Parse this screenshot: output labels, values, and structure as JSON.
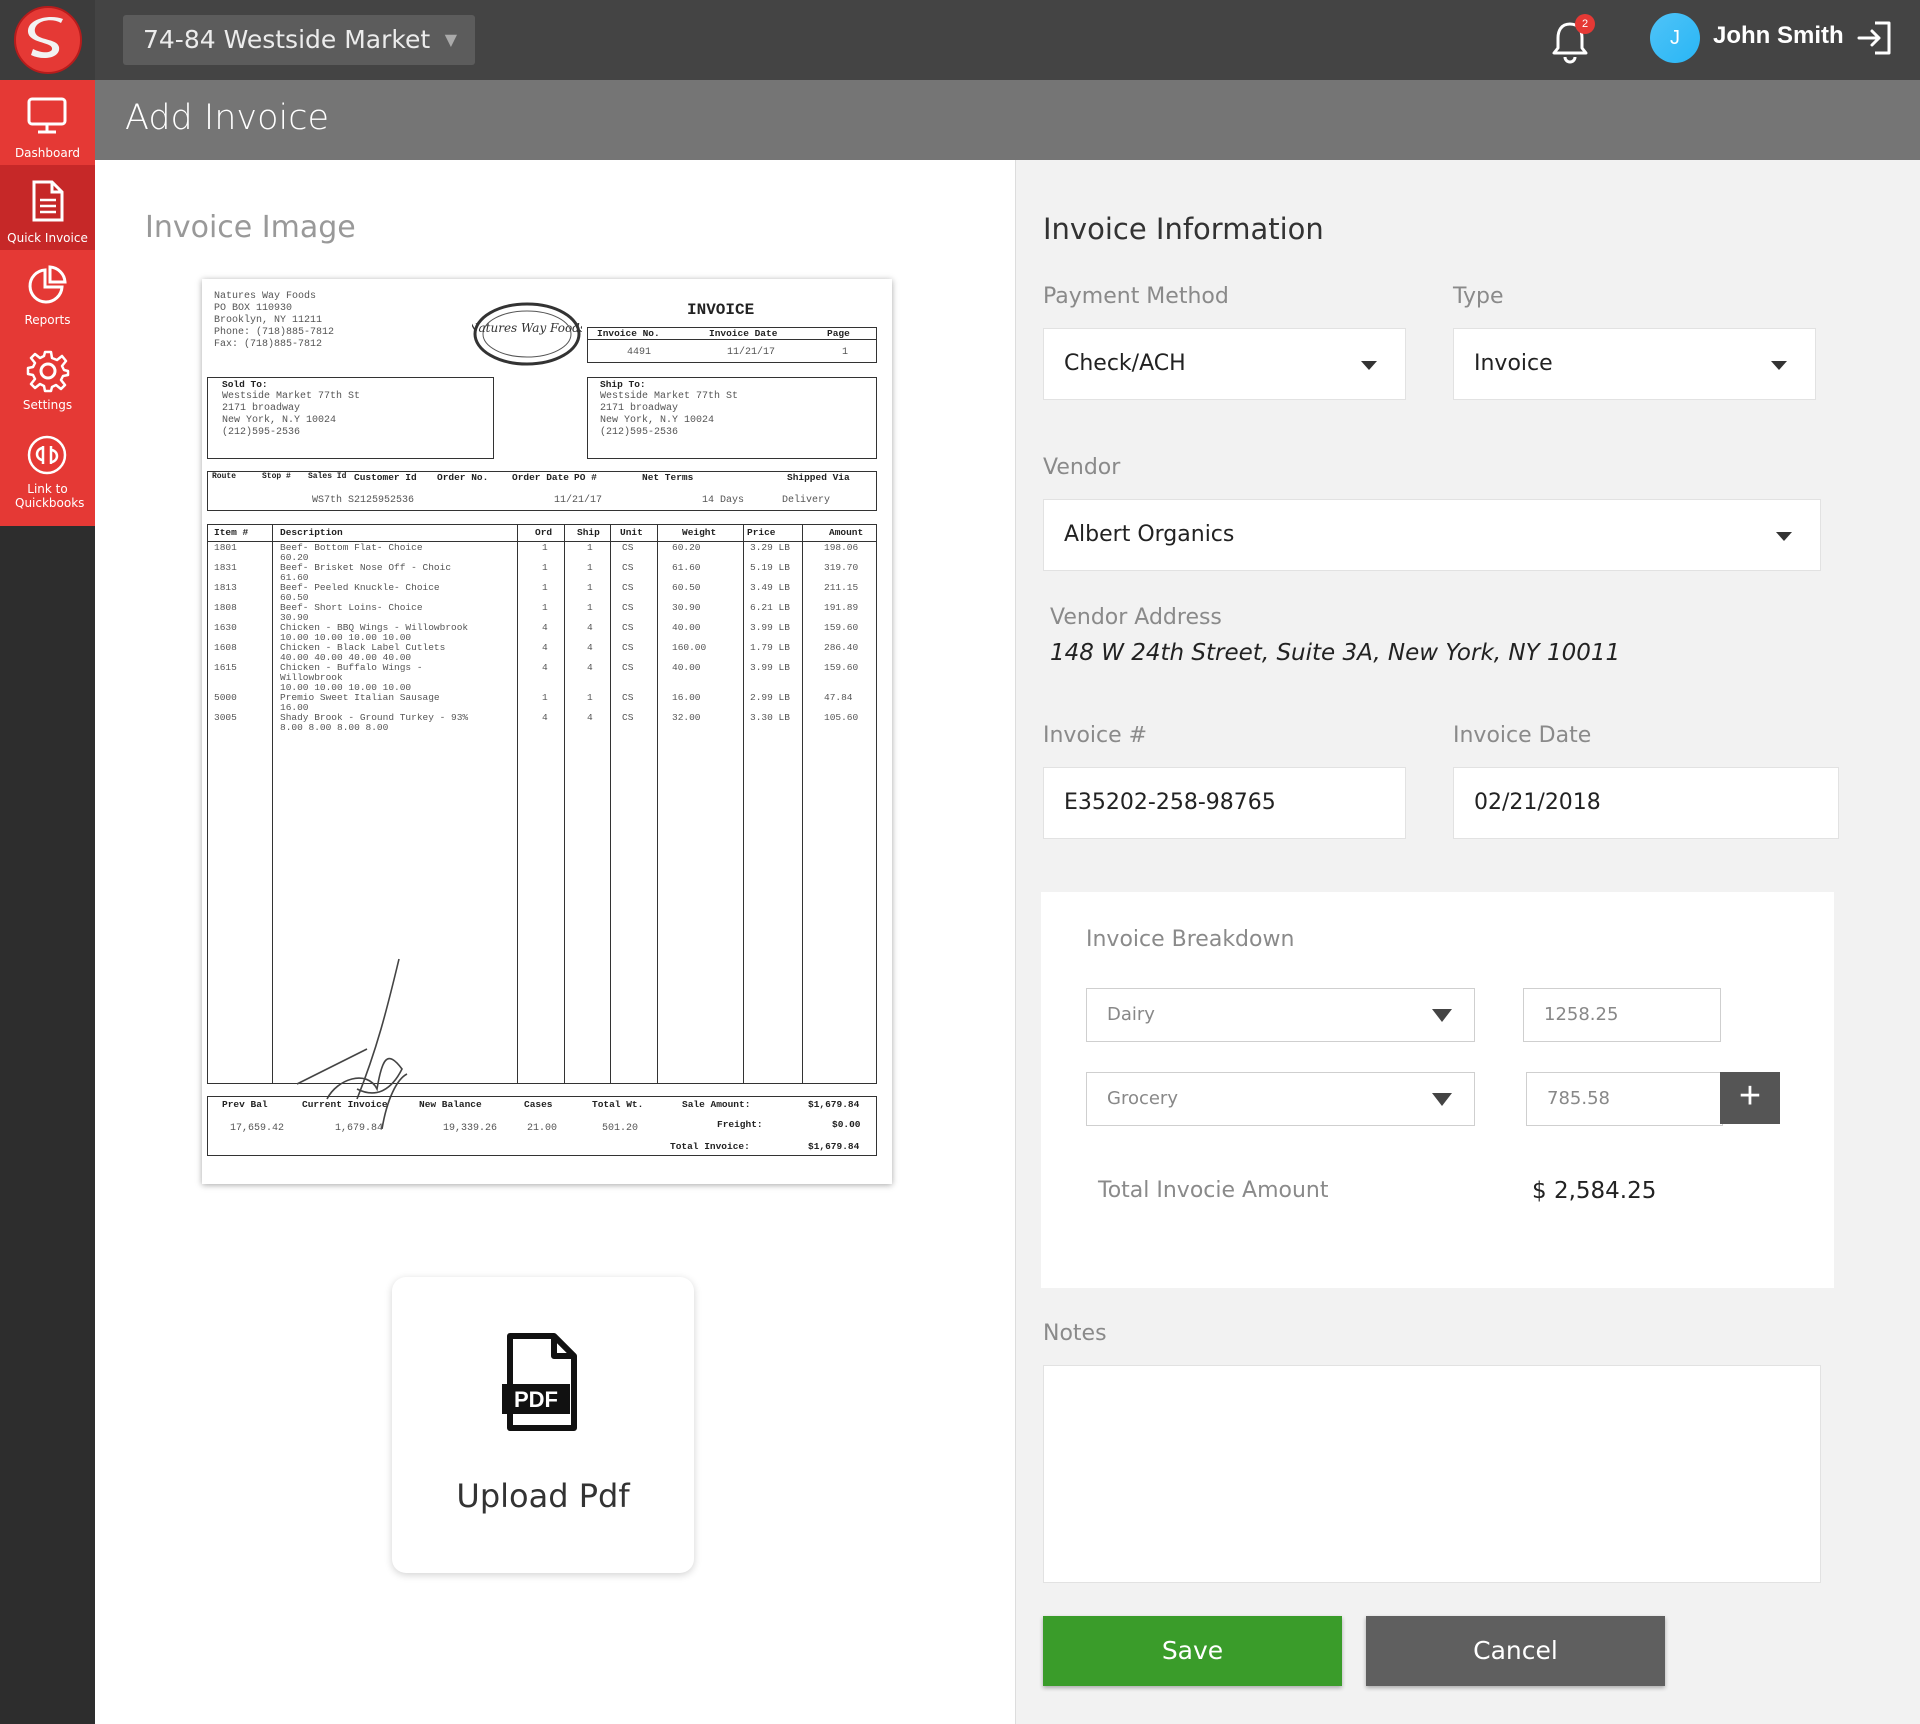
{
  "topbar": {
    "location": "74-84 Westside Market",
    "notification_count": "2",
    "user_initial": "J",
    "user_name": "John Smith"
  },
  "sidebar": {
    "items": [
      {
        "label": "Dashboard",
        "icon": "monitor-icon"
      },
      {
        "label": "Quick Invoice",
        "icon": "document-icon"
      },
      {
        "label": "Reports",
        "icon": "pie-chart-icon"
      },
      {
        "label": "Settings",
        "icon": "gear-icon"
      },
      {
        "label": "Link to Quickbooks",
        "icon": "quickbooks-icon"
      }
    ]
  },
  "page": {
    "title": "Add Invoice"
  },
  "left": {
    "image_title": "Invoice Image",
    "upload_label": "Upload Pdf",
    "pdf_icon_text": "PDF"
  },
  "invoice_doc": {
    "vendor": [
      "Natures Way Foods",
      "PO BOX 110930",
      "Brooklyn, NY 11211",
      "Phone: (718)885-7812",
      "Fax: (718)885-7812"
    ],
    "logo_text": "Natures Way Foods",
    "heading": "INVOICE",
    "meta_headers": [
      "Invoice No.",
      "Invoice Date",
      "Page"
    ],
    "meta_values": [
      "4491",
      "11/21/17",
      "1"
    ],
    "sold_to_label": "Sold To:",
    "sold_to": [
      "Westside Market 77th St",
      "2171 broadway",
      "New York, N.Y 10024",
      "(212)595-2536"
    ],
    "ship_to_label": "Ship To:",
    "ship_to": [
      "Westside Market 77th St",
      "2171 broadway",
      "New York, N.Y 10024",
      "(212)595-2536"
    ],
    "order_headers": [
      "Route",
      "Stop #",
      "Sales Id",
      "Customer Id",
      "Order No.",
      "Order Date",
      "PO #",
      "Net Terms",
      "Shipped Via"
    ],
    "order_values": [
      "",
      "",
      "WS7th S",
      "2125952536",
      "",
      "11/21/17",
      "",
      "14 Days",
      "Delivery"
    ],
    "item_headers": [
      "Item #",
      "Description",
      "Ord",
      "Ship",
      "Unit",
      "Weight",
      "Price",
      "Amount"
    ],
    "items": [
      {
        "item": "1801",
        "desc": "Beef- Bottom Flat- Choice\n60.20",
        "ord": "1",
        "ship": "1",
        "unit": "CS",
        "weight": "60.20",
        "price": "3.29 LB",
        "amount": "198.06"
      },
      {
        "item": "1831",
        "desc": "Beef- Brisket Nose Off - Choic\n61.60",
        "ord": "1",
        "ship": "1",
        "unit": "CS",
        "weight": "61.60",
        "price": "5.19 LB",
        "amount": "319.70"
      },
      {
        "item": "1813",
        "desc": "Beef- Peeled Knuckle- Choice\n60.50",
        "ord": "1",
        "ship": "1",
        "unit": "CS",
        "weight": "60.50",
        "price": "3.49 LB",
        "amount": "211.15"
      },
      {
        "item": "1808",
        "desc": "Beef- Short Loins- Choice\n30.90",
        "ord": "1",
        "ship": "1",
        "unit": "CS",
        "weight": "30.90",
        "price": "6.21 LB",
        "amount": "191.89"
      },
      {
        "item": "1630",
        "desc": "Chicken - BBQ Wings - Willowbrook\n10.00 10.00 10.00 10.00",
        "ord": "4",
        "ship": "4",
        "unit": "CS",
        "weight": "40.00",
        "price": "3.99 LB",
        "amount": "159.60"
      },
      {
        "item": "1608",
        "desc": "Chicken - Black Label Cutlets\n40.00 40.00 40.00 40.00",
        "ord": "4",
        "ship": "4",
        "unit": "CS",
        "weight": "160.00",
        "price": "1.79 LB",
        "amount": "286.40"
      },
      {
        "item": "1615",
        "desc": "Chicken - Buffalo Wings -\nWillowbrook\n10.00 10.00 10.00 10.00",
        "ord": "4",
        "ship": "4",
        "unit": "CS",
        "weight": "40.00",
        "price": "3.99 LB",
        "amount": "159.60"
      },
      {
        "item": "5000",
        "desc": "Premio Sweet Italian Sausage\n16.00",
        "ord": "1",
        "ship": "1",
        "unit": "CS",
        "weight": "16.00",
        "price": "2.99 LB",
        "amount": "47.84"
      },
      {
        "item": "3005",
        "desc": "Shady Brook - Ground Turkey - 93%\n8.00 8.00 8.00 8.00",
        "ord": "4",
        "ship": "4",
        "unit": "CS",
        "weight": "32.00",
        "price": "3.30 LB",
        "amount": "105.60"
      }
    ],
    "footer_headers": [
      "Prev Bal",
      "Current Invoice",
      "New Balance",
      "Cases",
      "Total Wt."
    ],
    "footer_values": [
      "17,659.42",
      "1,679.84",
      "19,339.26",
      "21.00",
      "501.20"
    ],
    "sale_amount_label": "Sale Amount:",
    "sale_amount": "$1,679.84",
    "freight_label": "Freight:",
    "freight": "$0.00",
    "total_invoice_label": "Total Invoice:",
    "total_invoice": "$1,679.84"
  },
  "form": {
    "title": "Invoice Information",
    "payment_method_label": "Payment Method",
    "payment_method": "Check/ACH",
    "type_label": "Type",
    "type": "Invoice",
    "vendor_label": "Vendor",
    "vendor": "Albert Organics",
    "vendor_address_label": "Vendor Address",
    "vendor_address": "148 W 24th Street, Suite 3A, New York, NY 10011",
    "invoice_no_label": "Invoice #",
    "invoice_no": "E35202-258-98765",
    "invoice_date_label": "Invoice Date",
    "invoice_date": "02/21/2018",
    "breakdown": {
      "title": "Invoice Breakdown",
      "rows": [
        {
          "category": "Dairy",
          "amount": "1258.25"
        },
        {
          "category": "Grocery",
          "amount": "785.58"
        }
      ],
      "add_label": "+",
      "total_label": "Total Invocie Amount",
      "total_value": "$ 2,584.25"
    },
    "notes_label": "Notes",
    "notes_value": "",
    "save_label": "Save",
    "cancel_label": "Cancel"
  },
  "colors": {
    "brand_red": "#e53935",
    "sidebar_dark": "#2d2d2d",
    "topbar": "#444444",
    "save_green": "#3a9c2a",
    "cancel_gray": "#5f5f5f"
  }
}
